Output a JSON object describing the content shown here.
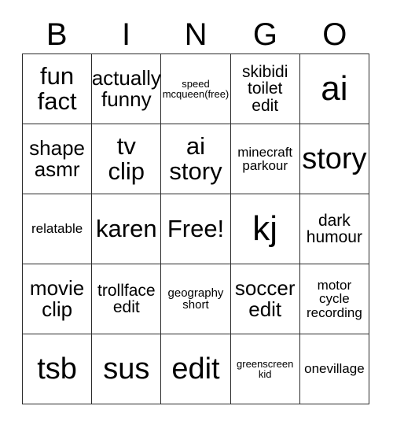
{
  "card": {
    "type": "bingo-card",
    "header_letters": [
      "B",
      "I",
      "N",
      "G",
      "O"
    ],
    "grid_size": "5x5",
    "free_space": "Free!",
    "colors": {
      "background": "#ffffff",
      "text": "#000000",
      "grid_line": "#2b2b2b"
    },
    "rows": [
      [
        {
          "text": "fun\nfact",
          "size": "fs-lg"
        },
        {
          "text": "actually\nfunny",
          "size": "fs-md"
        },
        {
          "text": "speed\nmcqueen(free)",
          "size": "fs-tiny"
        },
        {
          "text": "skibidi\ntoilet\nedit",
          "size": "fs-sm"
        },
        {
          "text": "ai",
          "size": "fs-xxl"
        }
      ],
      [
        {
          "text": "shape\nasmr",
          "size": "fs-md"
        },
        {
          "text": "tv\nclip",
          "size": "fs-lg"
        },
        {
          "text": "ai\nstory",
          "size": "fs-lg"
        },
        {
          "text": "minecraft\nparkour",
          "size": "fs-xs"
        },
        {
          "text": "story",
          "size": "fs-xl"
        }
      ],
      [
        {
          "text": "relatable",
          "size": "fs-xs"
        },
        {
          "text": "karen",
          "size": "fs-lg"
        },
        {
          "text": "Free!",
          "size": "fs-lg"
        },
        {
          "text": "kj",
          "size": "fs-xxl"
        },
        {
          "text": "dark\nhumour",
          "size": "fs-sm"
        }
      ],
      [
        {
          "text": "movie\nclip",
          "size": "fs-md"
        },
        {
          "text": "trollface\nedit",
          "size": "fs-sm"
        },
        {
          "text": "geography\nshort",
          "size": "fs-xxs"
        },
        {
          "text": "soccer\nedit",
          "size": "fs-md"
        },
        {
          "text": "motor\ncycle\nrecording",
          "size": "fs-xs"
        }
      ],
      [
        {
          "text": "tsb",
          "size": "fs-xl"
        },
        {
          "text": "sus",
          "size": "fs-xl"
        },
        {
          "text": "edit",
          "size": "fs-xl"
        },
        {
          "text": "greenscreen\nkid",
          "size": "fs-tiny"
        },
        {
          "text": "onevillage",
          "size": "fs-xs"
        }
      ]
    ]
  }
}
